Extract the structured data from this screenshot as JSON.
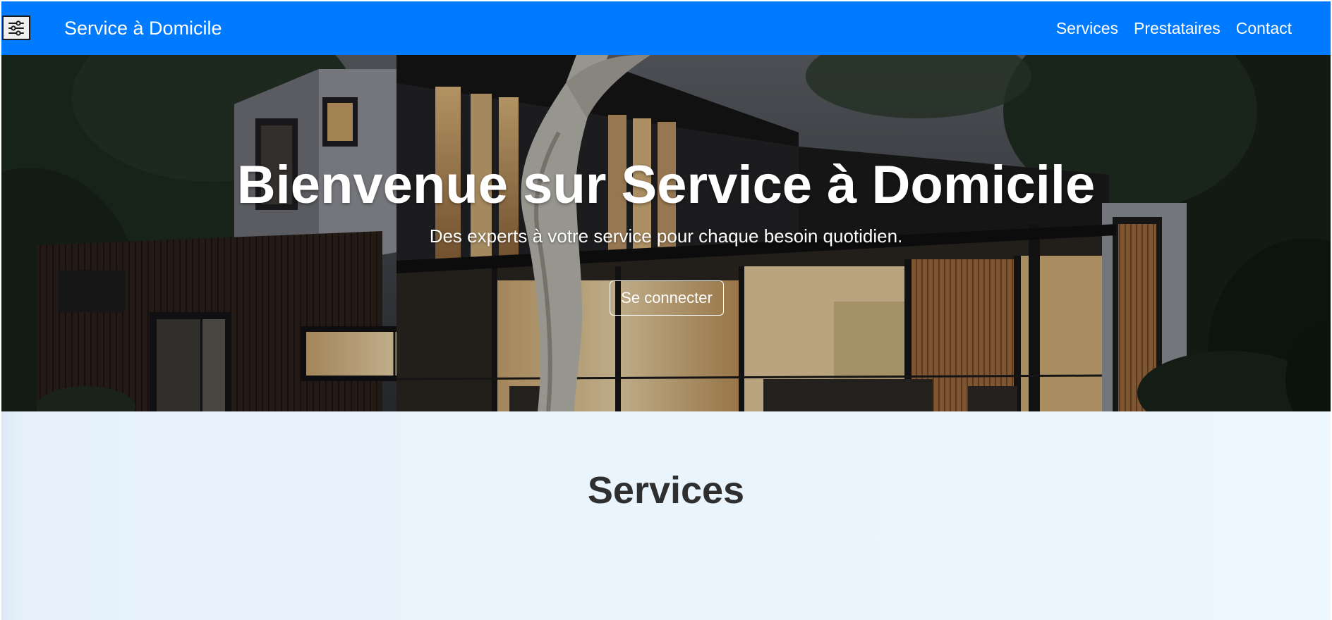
{
  "navbar": {
    "brand": "Service à Domicile",
    "menu_icon": "sliders-icon",
    "background_color": "#007bff",
    "links": [
      {
        "label": "Services"
      },
      {
        "label": "Prestataires"
      },
      {
        "label": "Contact"
      }
    ]
  },
  "hero": {
    "title": "Bienvenue sur Service à Domicile",
    "subtitle": "Des experts à votre service pour chaque besoin quotidien.",
    "button_label": "Se connecter"
  },
  "services": {
    "title": "Services"
  }
}
